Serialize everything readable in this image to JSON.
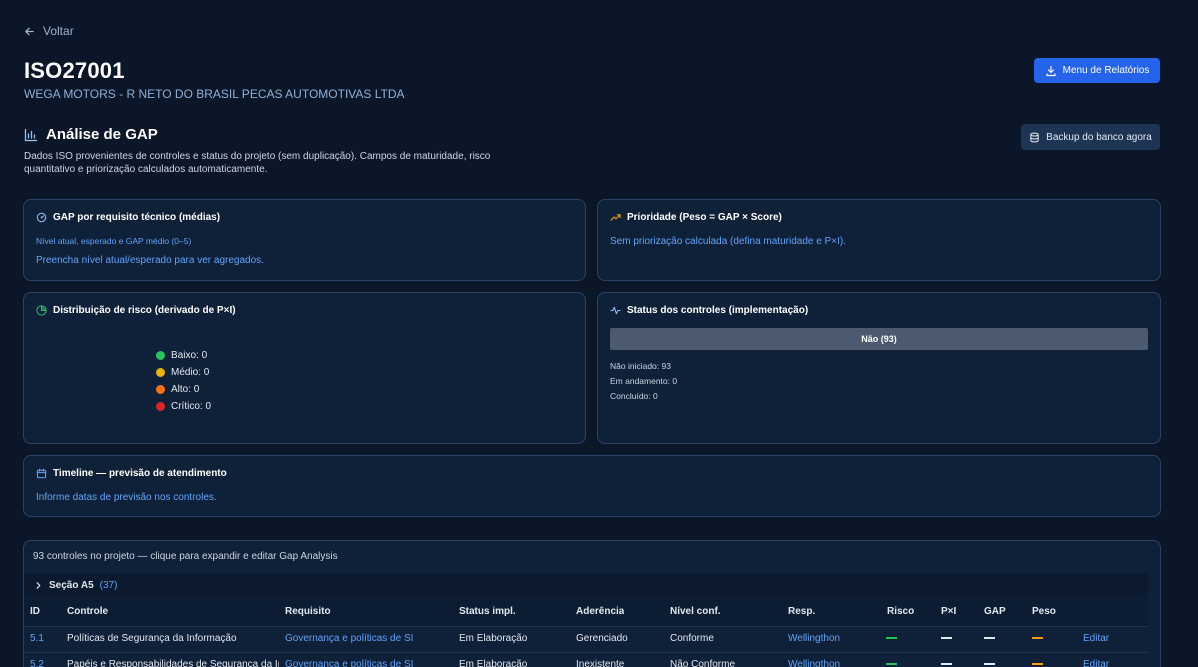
{
  "nav": {
    "back_label": "Voltar"
  },
  "header": {
    "title": "ISO27001",
    "company": "WEGA MOTORS - R NETO DO BRASIL PECAS AUTOMOTIVAS LTDA",
    "reports_button": "Menu de Relatórios"
  },
  "gap": {
    "title": "Análise de GAP",
    "description": "Dados ISO provenientes de controles e status do projeto (sem duplicação). Campos de maturidade, risco quantitativo e priorização calculados automaticamente.",
    "backup_button": "Backup do banco agora"
  },
  "cards": {
    "gap_req": {
      "title": "GAP por requisito técnico (médias)",
      "subtitle": "Nível atual, esperado e GAP médio (0–5)",
      "empty": "Preencha nível atual/esperado para ver agregados."
    },
    "priority": {
      "title": "Prioridade (Peso = GAP × Score)",
      "empty": "Sem priorização calculada (defina maturidade e P×I)."
    },
    "risk": {
      "title": "Distribuição de risco (derivado de P×I)",
      "legend": [
        {
          "label": "Baixo: 0",
          "color": "#22c55e"
        },
        {
          "label": "Médio: 0",
          "color": "#eab308"
        },
        {
          "label": "Alto: 0",
          "color": "#f97316"
        },
        {
          "label": "Crítico: 0",
          "color": "#dc2626"
        }
      ]
    },
    "status": {
      "title": "Status dos controles (implementação)",
      "bar_label": "Não (93)",
      "bar_fraction": 1.0,
      "lines": [
        "Não iniciado: 93",
        "Em andamento: 0",
        "Concluído: 0"
      ]
    },
    "timeline": {
      "title": "Timeline — previsão de atendimento",
      "empty": "Informe datas de previsão nos controles."
    }
  },
  "table": {
    "note": "93 controles no projeto — clique para expandir e editar Gap Analysis",
    "section_label": "Seção A5",
    "section_count": "(37)",
    "columns": [
      "ID",
      "Controle",
      "Requisito",
      "Status impl.",
      "Aderência",
      "Nível conf.",
      "Resp.",
      "Risco",
      "P×I",
      "GAP",
      "Peso"
    ],
    "rows": [
      {
        "id": "5.1",
        "control": "Políticas de Segurança da Informação",
        "requirement": "Governança e políticas de SI",
        "status": "Em Elaboração",
        "adherence": "Gerenciado",
        "level": "Conforme",
        "owner": "Wellingthon",
        "edit": "Editar"
      },
      {
        "id": "5.2",
        "control": "Papéis e Responsabilidades de Segurança da Informação",
        "requirement": "Governança e políticas de SI",
        "status": "Em Elaboração",
        "adherence": "Inexistente",
        "level": "Não Conforme",
        "owner": "Wellingthon",
        "edit": "Editar"
      }
    ],
    "dash_colors": {
      "risk": "#22c55e",
      "pxi": "#e2e8f0",
      "gap": "#e2e8f0",
      "weight": "#f59e0b"
    }
  }
}
